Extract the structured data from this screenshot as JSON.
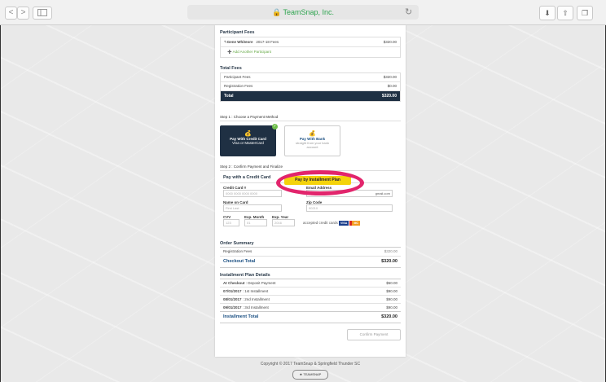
{
  "browser": {
    "nav_back": "<",
    "nav_forward": ">",
    "sidebar_icon": "sidebar-icon",
    "url_title": "TeamSnap, Inc.",
    "reload_icon": "reload-icon",
    "download_icon": "download-icon",
    "share_icon": "share-icon",
    "tabs_icon": "tabs-icon"
  },
  "participant_fees": {
    "title": "Participant Fees",
    "rows": [
      {
        "name": "Gene Whiteore",
        "item": "2017-18 Fees",
        "amount": "$320.00"
      }
    ],
    "add_link": "Add Another Participant"
  },
  "total_fees": {
    "title": "Total Fees",
    "rows": [
      {
        "label": "Participant Fees",
        "amount": "$320.00"
      },
      {
        "label": "Registration Fees",
        "amount": "$0.00"
      }
    ],
    "total_label": "Total",
    "total_amount": "$320.00"
  },
  "step1": {
    "label": "Step 1 : Choose a Payment Method",
    "credit": {
      "title": "Pay With Credit Card",
      "sub": "Visa or MasterCard"
    },
    "bank": {
      "title": "Pay With Bank",
      "sub": "straight from your bank account"
    }
  },
  "step2": {
    "label": "Step 2 : Confirm Payment and Finalize",
    "tab_credit": "Pay with a Credit Card",
    "tab_installment": "Pay by Installment Plan",
    "cc_label": "Credit Card #",
    "cc_placeholder": "0000 0000 0000 0000",
    "email_label": "Email Address",
    "email_value": "gmail.com",
    "name_label": "Name on Card",
    "name_placeholder": "First Last",
    "zip_label": "Zip Code",
    "zip_placeholder": "90210",
    "cvv_label": "CVV",
    "cvv_placeholder": "123",
    "month_label": "Exp. Month",
    "month_placeholder": "01",
    "year_label": "Exp. Year",
    "year_placeholder": "2016",
    "accepted": "accepted credit cards",
    "visa": "VISA",
    "mc": "MC"
  },
  "order_summary": {
    "title": "Order Summary",
    "rows": [
      {
        "label": "Registration Fees",
        "amount": "$320.00"
      }
    ],
    "checkout_label": "Checkout Total",
    "checkout_amount": "$320.00"
  },
  "installment": {
    "title": "Installment Plan Details",
    "rows": [
      {
        "date": "At Checkout",
        "desc": ": Deposit Payment",
        "amount": "$50.00"
      },
      {
        "date": "07/01/2017",
        "desc": ": 1st Installment",
        "amount": "$90.00"
      },
      {
        "date": "08/01/2017",
        "desc": ": 2nd Installment",
        "amount": "$90.00"
      },
      {
        "date": "09/01/2017",
        "desc": ": 3rd Installment",
        "amount": "$90.00"
      }
    ],
    "total_label": "Installment Total",
    "total_amount": "$320.00",
    "confirm": "Confirm Payment"
  },
  "footer": {
    "copyright": "Copyright © 2017 TeamSnap & Springfield Thunder SC",
    "powered": "TEAMSNAP"
  },
  "colors": {
    "accent": "#1f3043",
    "highlight": "#e2256c",
    "tab": "#f4d30b"
  }
}
